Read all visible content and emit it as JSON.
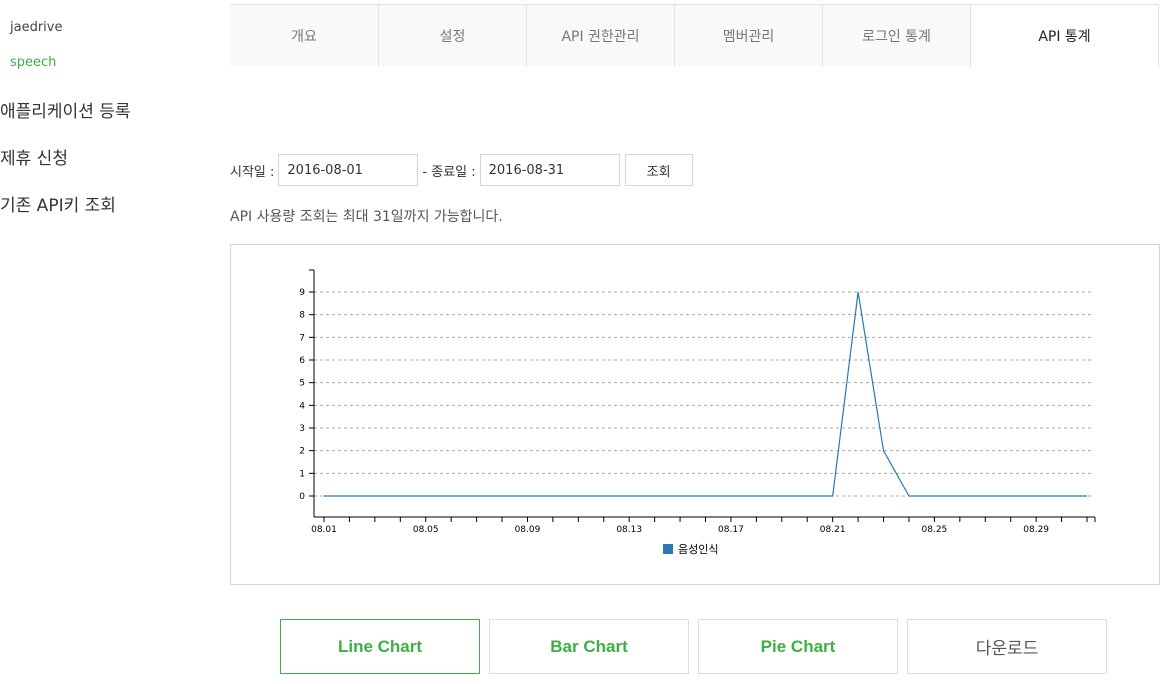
{
  "sidebar": {
    "app_name": "jaedrive",
    "app_sub": "speech",
    "links": [
      "애플리케이션 등록",
      "제휴 신청",
      "기존 API키 조회"
    ]
  },
  "tabs": [
    {
      "label": "개요",
      "active": false
    },
    {
      "label": "설정",
      "active": false
    },
    {
      "label": "API 권한관리",
      "active": false
    },
    {
      "label": "멤버관리",
      "active": false
    },
    {
      "label": "로그인 통계",
      "active": false
    },
    {
      "label": "API 통계",
      "active": true
    }
  ],
  "filter": {
    "start_label": "시작일 :",
    "start_value": "2016-08-01",
    "end_label": "- 종료일 :",
    "end_value": "2016-08-31",
    "query_button": "조회"
  },
  "notice": "API 사용량 조회는 최대 31일까지 가능합니다.",
  "chart_data": {
    "type": "line",
    "x": [
      "08.01",
      "08.02",
      "08.03",
      "08.04",
      "08.05",
      "08.06",
      "08.07",
      "08.08",
      "08.09",
      "08.10",
      "08.11",
      "08.12",
      "08.13",
      "08.14",
      "08.15",
      "08.16",
      "08.17",
      "08.18",
      "08.19",
      "08.20",
      "08.21",
      "08.22",
      "08.23",
      "08.24",
      "08.25",
      "08.26",
      "08.27",
      "08.28",
      "08.29",
      "08.30",
      "08.31"
    ],
    "x_tick_labels": [
      "08.01",
      "08.05",
      "08.09",
      "08.13",
      "08.17",
      "08.21",
      "08.25",
      "08.29"
    ],
    "series": [
      {
        "name": "음성인식",
        "color": "#2b78b4",
        "values": [
          0,
          0,
          0,
          0,
          0,
          0,
          0,
          0,
          0,
          0,
          0,
          0,
          0,
          0,
          0,
          0,
          0,
          0,
          0,
          0,
          0,
          9,
          2,
          0,
          0,
          0,
          0,
          0,
          0,
          0,
          0
        ]
      }
    ],
    "ylim": [
      0,
      9
    ],
    "y_ticks": [
      0,
      1,
      2,
      3,
      4,
      5,
      6,
      7,
      8,
      9
    ],
    "grid": true,
    "legend_position": "bottom"
  },
  "bottom_buttons": [
    {
      "label": "Line Chart",
      "active": true
    },
    {
      "label": "Bar Chart",
      "active": false
    },
    {
      "label": "Pie Chart",
      "active": false
    },
    {
      "label": "다운로드",
      "active": false
    }
  ]
}
